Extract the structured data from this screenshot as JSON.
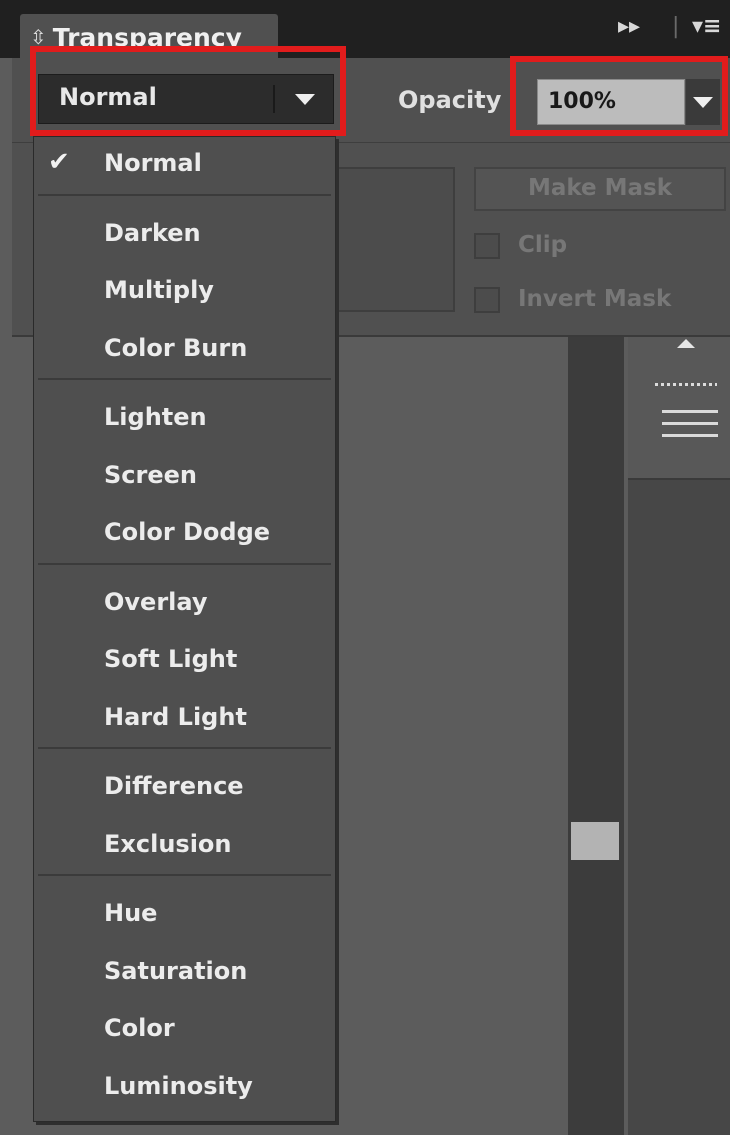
{
  "panel": {
    "title": "Transparency",
    "tab_icon": "up-down-arrows-icon",
    "forward_icon": "double-chevron-right-icon",
    "menu_icon": "panel-menu-icon"
  },
  "blend_mode": {
    "selected": "Normal"
  },
  "opacity": {
    "label": "Opacity",
    "value": "100%"
  },
  "mask_controls": {
    "make_mask": "Make Mask",
    "clip": "Clip",
    "invert_mask": "Invert Mask"
  },
  "menu": {
    "groups": [
      [
        "Normal"
      ],
      [
        "Darken",
        "Multiply",
        "Color Burn"
      ],
      [
        "Lighten",
        "Screen",
        "Color Dodge"
      ],
      [
        "Overlay",
        "Soft Light",
        "Hard Light"
      ],
      [
        "Difference",
        "Exclusion"
      ],
      [
        "Hue",
        "Saturation",
        "Color",
        "Luminosity"
      ]
    ],
    "checked": "Normal",
    "check_glyph": "✔"
  },
  "colors": {
    "highlight": "#e11c1c",
    "panel": "#505050",
    "menu_bg": "#4f4f4f"
  }
}
